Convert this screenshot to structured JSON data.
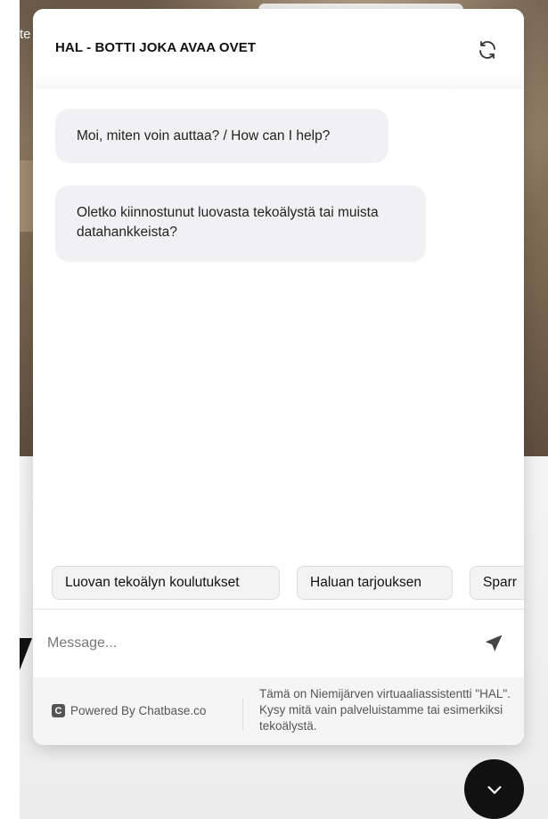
{
  "background": {
    "partial_text": "te"
  },
  "header": {
    "title": "HAL - BOTTI JOKA AVAA OVET",
    "refresh_icon": "refresh-icon"
  },
  "messages": [
    {
      "role": "assistant",
      "text": "Moi, miten voin auttaa? / How can I help?"
    },
    {
      "role": "assistant",
      "text": "Oletko kiinnostunut luovasta tekoälystä tai muista datahankkeista?"
    }
  ],
  "suggestions": [
    "Luovan tekoälyn koulutukset",
    "Haluan tarjouksen",
    "Sparr"
  ],
  "composer": {
    "placeholder": "Message...",
    "send_icon": "send-icon"
  },
  "footer": {
    "powered_by": "Powered By Chatbase.co",
    "logo_letter": "C",
    "note": "Tämä on Niemijärven virtuaaliassistentti \"HAL\". Kysy mitä vain palveluistamme tai esimerkiksi tekoälystä."
  },
  "launcher": {
    "icon": "chevron-down-icon"
  },
  "colors": {
    "bubble_bg": "#f1f1f3",
    "footer_bg": "#f5f5f6",
    "launcher_bg": "#111111"
  }
}
